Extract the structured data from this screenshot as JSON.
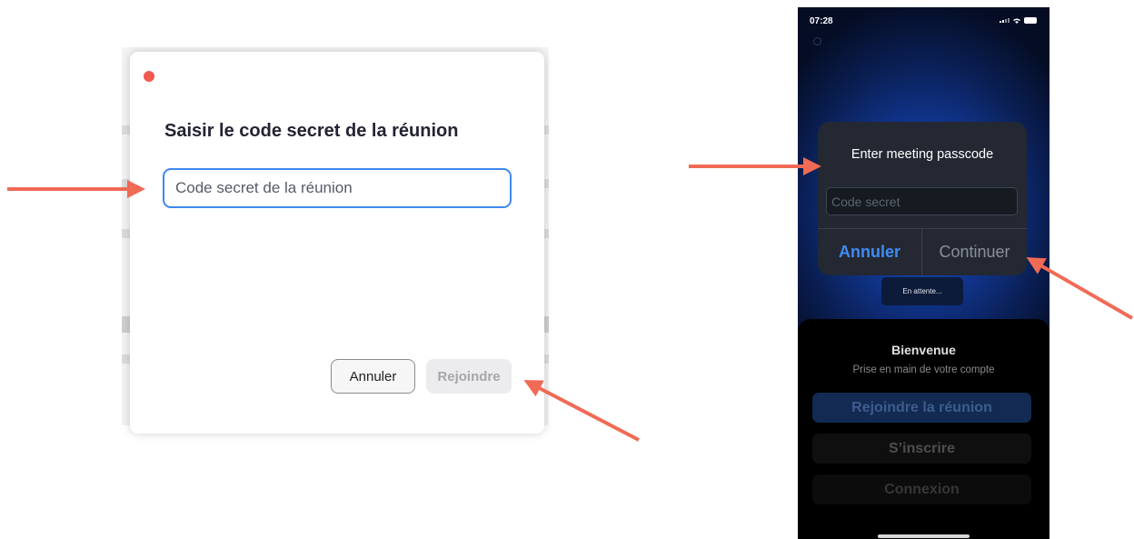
{
  "desktop_dialog": {
    "title": "Saisir le code secret de la réunion",
    "input_placeholder": "Code secret de la réunion",
    "input_value": "",
    "cancel_label": "Annuler",
    "join_label": "Rejoindre"
  },
  "mobile": {
    "status_time": "07:28",
    "alert": {
      "title": "Enter meeting passcode",
      "input_placeholder": "Code secret",
      "cancel_label": "Annuler",
      "continue_label": "Continuer"
    },
    "waiting_label": "En attente...",
    "sheet": {
      "welcome": "Bienvenue",
      "subtitle": "Prise en main de votre compte",
      "join_meeting_label": "Rejoindre la réunion",
      "signup_label": "S’inscrire",
      "login_label": "Connexion"
    }
  },
  "colors": {
    "arrow": "#f06a55",
    "input_focus": "#3d89f0",
    "ios_link": "#3f8cf5"
  }
}
